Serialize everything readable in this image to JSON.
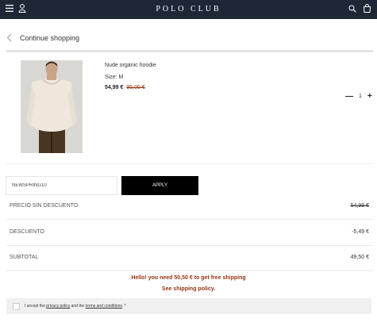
{
  "header": {
    "brand": "POLO CLUB"
  },
  "nav": {
    "continue_label": "Continue shopping"
  },
  "product": {
    "name": "Nude organic hoodie",
    "size": "Size: M",
    "price": "54,99 €",
    "old_price": "95,00 €",
    "quantity": "1"
  },
  "coupon": {
    "value": "NEWSPRING10",
    "apply_label": "APPLY"
  },
  "summary": [
    {
      "label": "PRECIO SIN DESCUENTO",
      "value": "54,99 €"
    },
    {
      "label": "DESCUENTO",
      "value": "-5,49 €"
    },
    {
      "label": "SUBTOTAL",
      "value": "49,50 €"
    }
  ],
  "shipping": {
    "message": "Hello! you need 50,50 € to get free shipping",
    "policy_link": "See shipping policy."
  },
  "terms": {
    "prefix": "I accept the",
    "privacy_link": "privacy policy",
    "and": "and the",
    "terms_link": "terms and conditions",
    "suffix": ". *"
  },
  "colors": {
    "header_bg": "#1d2736",
    "accent": "#9a3412",
    "button_bg": "#000000"
  }
}
